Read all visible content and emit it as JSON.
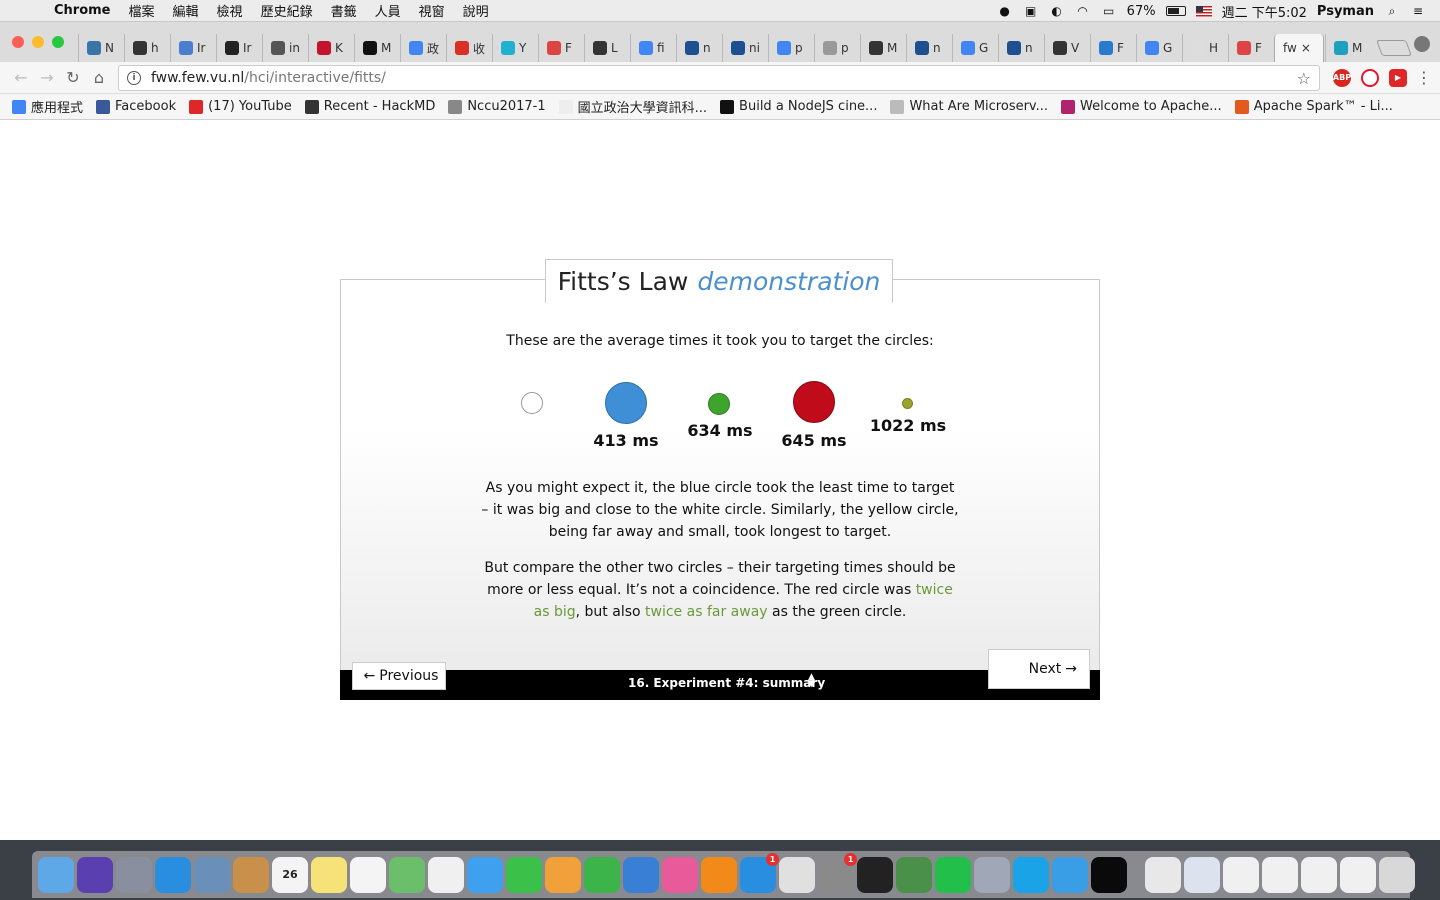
{
  "menubar": {
    "app_name": "Chrome",
    "menus": [
      "檔案",
      "編輯",
      "檢視",
      "歷史紀錄",
      "書籤",
      "人員",
      "視窗",
      "說明"
    ],
    "battery": "67%",
    "clock": "週二 下午5:02",
    "user": "Psyman"
  },
  "tabs": [
    {
      "label": "N",
      "icon": "python-icon",
      "color": "#3a75a8"
    },
    {
      "label": "h",
      "icon": "doc-icon",
      "color": "#333333"
    },
    {
      "label": "Ir",
      "icon": "infinity-icon",
      "color": "#4a7fd0"
    },
    {
      "label": "Ir",
      "icon": "doc-icon",
      "color": "#222222"
    },
    {
      "label": "in",
      "icon": "circle-icon",
      "color": "#555555"
    },
    {
      "label": "K",
      "icon": "k-icon",
      "color": "#c4142b"
    },
    {
      "label": "M",
      "icon": "github-icon",
      "color": "#111111"
    },
    {
      "label": "政",
      "icon": "google-icon",
      "color": "#4285f4"
    },
    {
      "label": "收",
      "icon": "gmail-icon",
      "color": "#d93025"
    },
    {
      "label": "Y",
      "icon": "y-icon",
      "color": "#20b0d0"
    },
    {
      "label": "F",
      "icon": "ptt-icon",
      "color": "#d44"
    },
    {
      "label": "L",
      "icon": "wiki-icon",
      "color": "#333333"
    },
    {
      "label": "fi",
      "icon": "google-icon",
      "color": "#4285f4"
    },
    {
      "label": "n",
      "icon": "s-icon",
      "color": "#1d4f91"
    },
    {
      "label": "ni",
      "icon": "s-icon",
      "color": "#1d4f91"
    },
    {
      "label": "p",
      "icon": "google-icon",
      "color": "#4285f4"
    },
    {
      "label": "p",
      "icon": "compass-icon",
      "color": "#999999"
    },
    {
      "label": "M",
      "icon": "wiki-icon",
      "color": "#333333"
    },
    {
      "label": "n",
      "icon": "s-icon",
      "color": "#1d4f91"
    },
    {
      "label": "G",
      "icon": "translate-icon",
      "color": "#4285f4"
    },
    {
      "label": "n",
      "icon": "s-icon",
      "color": "#1d4f91"
    },
    {
      "label": "V",
      "icon": "wiki-icon",
      "color": "#333333"
    },
    {
      "label": "F",
      "icon": "moon-icon",
      "color": "#2a7bd0"
    },
    {
      "label": "G",
      "icon": "google-icon",
      "color": "#4285f4"
    },
    {
      "label": "H",
      "icon": "blank-icon",
      "color": "#dddddd"
    },
    {
      "label": "F",
      "icon": "ptt-icon",
      "color": "#d44"
    },
    {
      "label": "fw",
      "icon": "none",
      "color": "#f6f6f6",
      "active": true
    },
    {
      "label": "M",
      "icon": "plus-icon",
      "color": "#20a0c0"
    }
  ],
  "address_bar": {
    "host": "fww.few.vu.nl",
    "path": "/hci/interactive/fitts/"
  },
  "bookmarks": [
    {
      "label": "應用程式",
      "icon": "apps-grid-icon",
      "color": "#4285f4"
    },
    {
      "label": "Facebook",
      "icon": "facebook-icon",
      "color": "#3b5998"
    },
    {
      "label": "(17) YouTube",
      "icon": "youtube-icon",
      "color": "#e02727"
    },
    {
      "label": "Recent - HackMD",
      "icon": "doc-icon",
      "color": "#333333"
    },
    {
      "label": "Nccu2017-1",
      "icon": "folder-icon",
      "color": "#888888"
    },
    {
      "label": "國立政治大學資訊科...",
      "icon": "blank-icon",
      "color": "#eeeeee"
    },
    {
      "label": "Build a NodeJS cine...",
      "icon": "medium-icon",
      "color": "#111111"
    },
    {
      "label": "What Are Microserv...",
      "icon": "page-icon",
      "color": "#bbbbbb"
    },
    {
      "label": "Welcome to Apache...",
      "icon": "feather-icon",
      "color": "#b0246f"
    },
    {
      "label": "Apache Spark™ - Li...",
      "icon": "star-outline-icon",
      "color": "#e25a1c"
    }
  ],
  "page": {
    "title_main": "Fitts’s Law",
    "title_accent": "demonstration",
    "intro": "These are the average times it took you to target the circles:",
    "results": [
      {
        "circle": "white",
        "time": ""
      },
      {
        "circle": "blue",
        "time": "413 ms"
      },
      {
        "circle": "green",
        "time": "634 ms"
      },
      {
        "circle": "red",
        "time": "645 ms"
      },
      {
        "circle": "yellow",
        "time": "1022 ms"
      }
    ],
    "paragraph1": "As you might expect it, the blue circle took the least time to target – it was big and close to the white circle. Similarly, the yellow circle, being far away and small, took longest to target.",
    "paragraph2_part1": "But compare the other two circles – their targeting times should be more or less equal. It’s not a coincidence. The red circle was ",
    "paragraph2_hl1": "twice as big",
    "paragraph2_part2": ", but also ",
    "paragraph2_hl2": "twice as far away",
    "paragraph2_part3": " as the green circle.",
    "prev_label": "Previous",
    "next_label": "Next",
    "step_label": "16. Experiment #4: summary",
    "colors": {
      "accent": "#4a8fd0",
      "highlight": "#6a9a3c",
      "blue": "#3f8fd6",
      "green": "#3fa42e",
      "red": "#bf0b1a",
      "yellow": "#9aa32b"
    }
  },
  "dock": [
    {
      "name": "finder-icon",
      "color": "#5fa8e8"
    },
    {
      "name": "siri-icon",
      "color": "#5a3fb0"
    },
    {
      "name": "launchpad-icon",
      "color": "#8a8fa0"
    },
    {
      "name": "safari-icon",
      "color": "#2a8ee0"
    },
    {
      "name": "mail-stamp-icon",
      "color": "#6a8fb8"
    },
    {
      "name": "contacts-icon",
      "color": "#c8904a"
    },
    {
      "name": "calendar-icon",
      "color": "#f4f4f4",
      "text": "26"
    },
    {
      "name": "notes-icon",
      "color": "#f7e27a"
    },
    {
      "name": "reminders-icon",
      "color": "#f4f4f4"
    },
    {
      "name": "maps-icon",
      "color": "#6cbf6a"
    },
    {
      "name": "photos-icon",
      "color": "#f0f0f0"
    },
    {
      "name": "messages-icon",
      "color": "#3fa0f0"
    },
    {
      "name": "facetime-icon",
      "color": "#3bc04a"
    },
    {
      "name": "pages-icon",
      "color": "#f2a13a"
    },
    {
      "name": "numbers-icon",
      "color": "#3cb44a"
    },
    {
      "name": "keynote-icon",
      "color": "#3a7fd6"
    },
    {
      "name": "itunes-icon",
      "color": "#e85a9a"
    },
    {
      "name": "ibooks-icon",
      "color": "#f28a1a"
    },
    {
      "name": "app-store-icon",
      "color": "#2a8ee0",
      "badge": "1"
    },
    {
      "name": "chrome-icon",
      "color": "#e0e0e0"
    },
    {
      "name": "system-preferences-icon",
      "color": "#8a8a8a",
      "badge": "1"
    },
    {
      "name": "terminal-icon",
      "color": "#222222"
    },
    {
      "name": "android-studio-icon",
      "color": "#4a8f4a"
    },
    {
      "name": "line-icon",
      "color": "#22c04a"
    },
    {
      "name": "image-capture-icon",
      "color": "#a0a8b8"
    },
    {
      "name": "skype-icon",
      "color": "#1aa3e6"
    },
    {
      "name": "docker-icon",
      "color": "#3a9ee6"
    },
    {
      "name": "cloud-app-icon",
      "color": "#0a0a0a"
    },
    {
      "name": "documents-icon",
      "color": "#e8e8e8"
    },
    {
      "name": "downloads-stack-icon",
      "color": "#dde3ee"
    },
    {
      "name": "window-thumb-icon",
      "color": "#f0f0f0"
    },
    {
      "name": "window-thumb-icon",
      "color": "#f0f0f0"
    },
    {
      "name": "window-thumb-icon",
      "color": "#f0f0f0"
    },
    {
      "name": "window-thumb-icon",
      "color": "#f0f0f0"
    },
    {
      "name": "trash-icon",
      "color": "#d8d8d8"
    }
  ]
}
